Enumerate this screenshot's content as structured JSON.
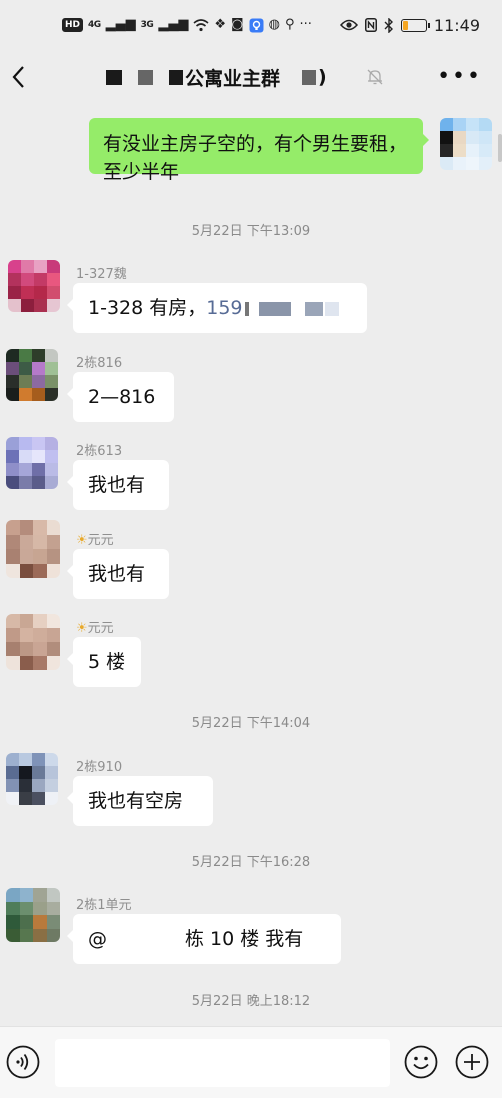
{
  "status_bar": {
    "hd_label": "HD",
    "sim1_label": "4G",
    "sim2_label": "3G",
    "more_label": "···",
    "time": "11:49"
  },
  "header": {
    "title": "公寓业主群",
    "title_suffix": ")",
    "muted": true
  },
  "messages": [
    {
      "type": "outgoing",
      "text": "有没业主房子空的，有个男生要租，至少半年"
    },
    {
      "type": "time",
      "text": "5月22日 下午13:09"
    },
    {
      "type": "incoming",
      "sender": "1-327魏",
      "text": "1-328 有房，",
      "text_partial": "159"
    },
    {
      "type": "incoming",
      "sender": "2栋816",
      "text": "2—816"
    },
    {
      "type": "incoming",
      "sender": "2栋613",
      "text": "我也有"
    },
    {
      "type": "incoming",
      "sender_prefix": "☀",
      "sender": "元元",
      "text": "我也有"
    },
    {
      "type": "incoming",
      "sender_prefix": "☀",
      "sender": "元元",
      "text": "5 楼"
    },
    {
      "type": "time",
      "text": "5月22日 下午14:04"
    },
    {
      "type": "incoming",
      "sender": "2栋910",
      "text": "我也有空房"
    },
    {
      "type": "time",
      "text": "5月22日 下午16:28"
    },
    {
      "type": "incoming",
      "sender": "2栋1单元",
      "text_at": "@",
      "text": "栋 10 楼  我有"
    },
    {
      "type": "time",
      "text": "5月22日 晚上18:12"
    }
  ],
  "input_bar": {
    "placeholder": "",
    "value": ""
  },
  "icons": {
    "back": "back-chevron-icon",
    "mute": "bell-mute-icon",
    "more": "more-dots-icon",
    "voice": "voice-icon",
    "emoji": "emoji-icon",
    "plus": "plus-circle-icon"
  },
  "colors": {
    "background": "#ededed",
    "outgoing_bubble": "#95ec69",
    "incoming_bubble": "#ffffff",
    "meta_text": "#8a8a8a",
    "link_partial": "#576b95"
  }
}
